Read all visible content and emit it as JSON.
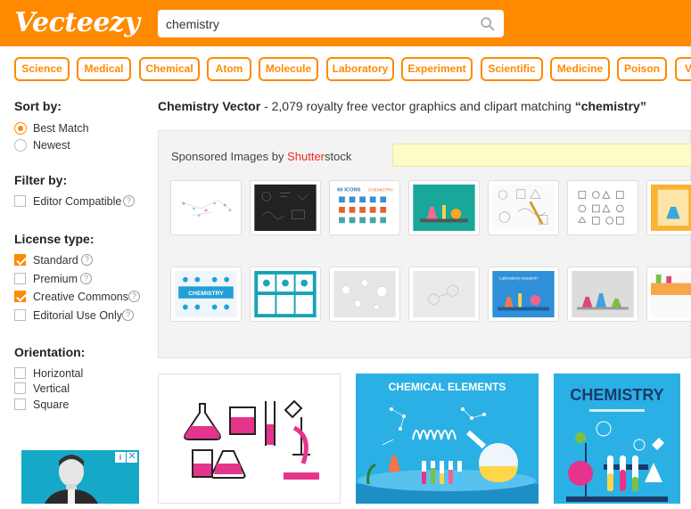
{
  "header": {
    "logo": "Vecteezy",
    "search_value": "chemistry",
    "accent": "#ff8a00"
  },
  "tags": [
    "Science",
    "Medical",
    "Chemical",
    "Atom",
    "Molecule",
    "Laboratory",
    "Experiment",
    "Scientific",
    "Medicine",
    "Poison",
    "V"
  ],
  "sidebar": {
    "sort": {
      "heading": "Sort by:",
      "options": [
        {
          "label": "Best Match",
          "selected": true
        },
        {
          "label": "Newest",
          "selected": false
        }
      ]
    },
    "filter": {
      "heading": "Filter by:",
      "options": [
        {
          "label": "Editor Compatible",
          "checked": false
        }
      ]
    },
    "license": {
      "heading": "License type:",
      "options": [
        {
          "label": "Standard",
          "checked": true
        },
        {
          "label": "Premium",
          "checked": false
        },
        {
          "label": "Creative Commons",
          "checked": true
        },
        {
          "label": "Editorial Use Only",
          "checked": false
        }
      ]
    },
    "orientation": {
      "heading": "Orientation:",
      "options": [
        {
          "label": "Horizontal",
          "checked": false
        },
        {
          "label": "Vertical",
          "checked": false
        },
        {
          "label": "Square",
          "checked": false
        }
      ]
    },
    "help_glyph": "?"
  },
  "ad": {
    "close": "✕",
    "info": "i"
  },
  "main": {
    "title_bold": "Chemistry Vector",
    "title_rest": "- 2,079 royalty free vector graphics and clipart matching",
    "title_query": "“chemistry”",
    "sponsored_prefix": "Sponsored Images by",
    "sponsored_brand_a": "Shutter",
    "sponsored_brand_b": "stock"
  },
  "results": [
    {
      "title": ""
    },
    {
      "title": "CHEMICAL ELEMENTS"
    },
    {
      "title": "CHEMISTRY"
    }
  ],
  "thumb_card": {
    "icons_label": "60 ICONS",
    "chem_label": "CHEMISTRY",
    "lab_label": "Laboratory research"
  }
}
